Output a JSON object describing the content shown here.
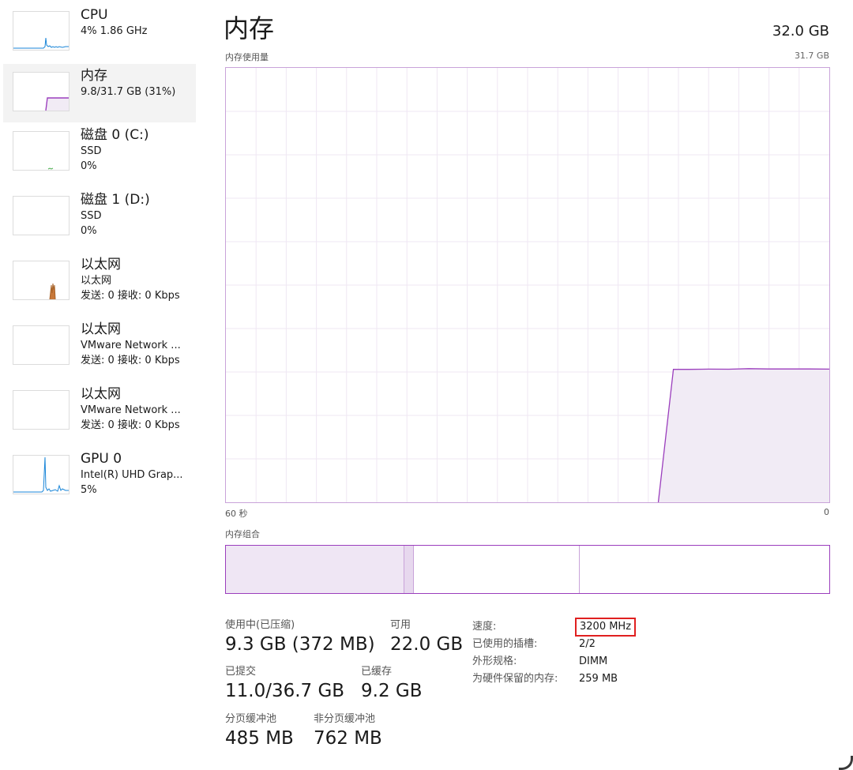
{
  "sidebar": {
    "items": [
      {
        "title": "CPU",
        "lines": [
          "4% 1.86 GHz"
        ],
        "color": "#1a86d8",
        "selected": false
      },
      {
        "title": "内存",
        "lines": [
          "9.8/31.7 GB (31%)"
        ],
        "color": "#9b3ebd",
        "selected": true
      },
      {
        "title": "磁盘 0 (C:)",
        "lines": [
          "SSD",
          "0%"
        ],
        "color": "#4caf50",
        "selected": false
      },
      {
        "title": "磁盘 1 (D:)",
        "lines": [
          "SSD",
          "0%"
        ],
        "color": "#4caf50",
        "selected": false
      },
      {
        "title": "以太网",
        "lines": [
          "以太网",
          "发送: 0 接收: 0 Kbps"
        ],
        "color": "#a8642a",
        "selected": false
      },
      {
        "title": "以太网",
        "lines": [
          "VMware Network ...",
          "发送: 0 接收: 0 Kbps"
        ],
        "color": "#a8642a",
        "selected": false
      },
      {
        "title": "以太网",
        "lines": [
          "VMware Network ...",
          "发送: 0 接收: 0 Kbps"
        ],
        "color": "#a8642a",
        "selected": false
      },
      {
        "title": "GPU 0",
        "lines": [
          "Intel(R) UHD Grap...",
          "5%"
        ],
        "color": "#1a86d8",
        "selected": false
      }
    ]
  },
  "header": {
    "title": "内存",
    "total": "32.0 GB",
    "chart_label": "内存使用量",
    "chart_max": "31.7 GB"
  },
  "axis": {
    "left": "60 秒",
    "right": "0"
  },
  "composition": {
    "label": "内存组合",
    "fractions": {
      "in_use": 0.295,
      "modified": 0.017,
      "standby": 0.275,
      "free": 0.413
    }
  },
  "stats": {
    "in_use_label": "使用中(已压缩)",
    "in_use_value": "9.3 GB (372 MB)",
    "available_label": "可用",
    "available_value": "22.0 GB",
    "committed_label": "已提交",
    "committed_value": "11.0/36.7 GB",
    "cached_label": "已缓存",
    "cached_value": "9.2 GB",
    "paged_label": "分页缓冲池",
    "paged_value": "485 MB",
    "nonpaged_label": "非分页缓冲池",
    "nonpaged_value": "762 MB"
  },
  "info": {
    "speed_label": "速度:",
    "speed_value": "3200 MHz",
    "slots_label": "已使用的插槽:",
    "slots_value": "2/2",
    "form_label": "外形规格:",
    "form_value": "DIMM",
    "reserved_label": "为硬件保留的内存:",
    "reserved_value": "259 MB"
  },
  "chart_data": {
    "type": "area",
    "ylim": [
      0,
      31.7
    ],
    "xlim": [
      60,
      0
    ],
    "x": [
      60,
      17,
      15.5,
      14,
      12,
      10,
      8,
      6,
      4,
      2,
      0
    ],
    "series": [
      {
        "values": [
          null,
          0,
          9.7,
          9.7,
          9.72,
          9.71,
          9.75,
          9.73,
          9.73,
          9.73,
          9.72
        ]
      }
    ],
    "color": "#9b3ebd",
    "fill": "#f1ebf5",
    "grid": true
  }
}
